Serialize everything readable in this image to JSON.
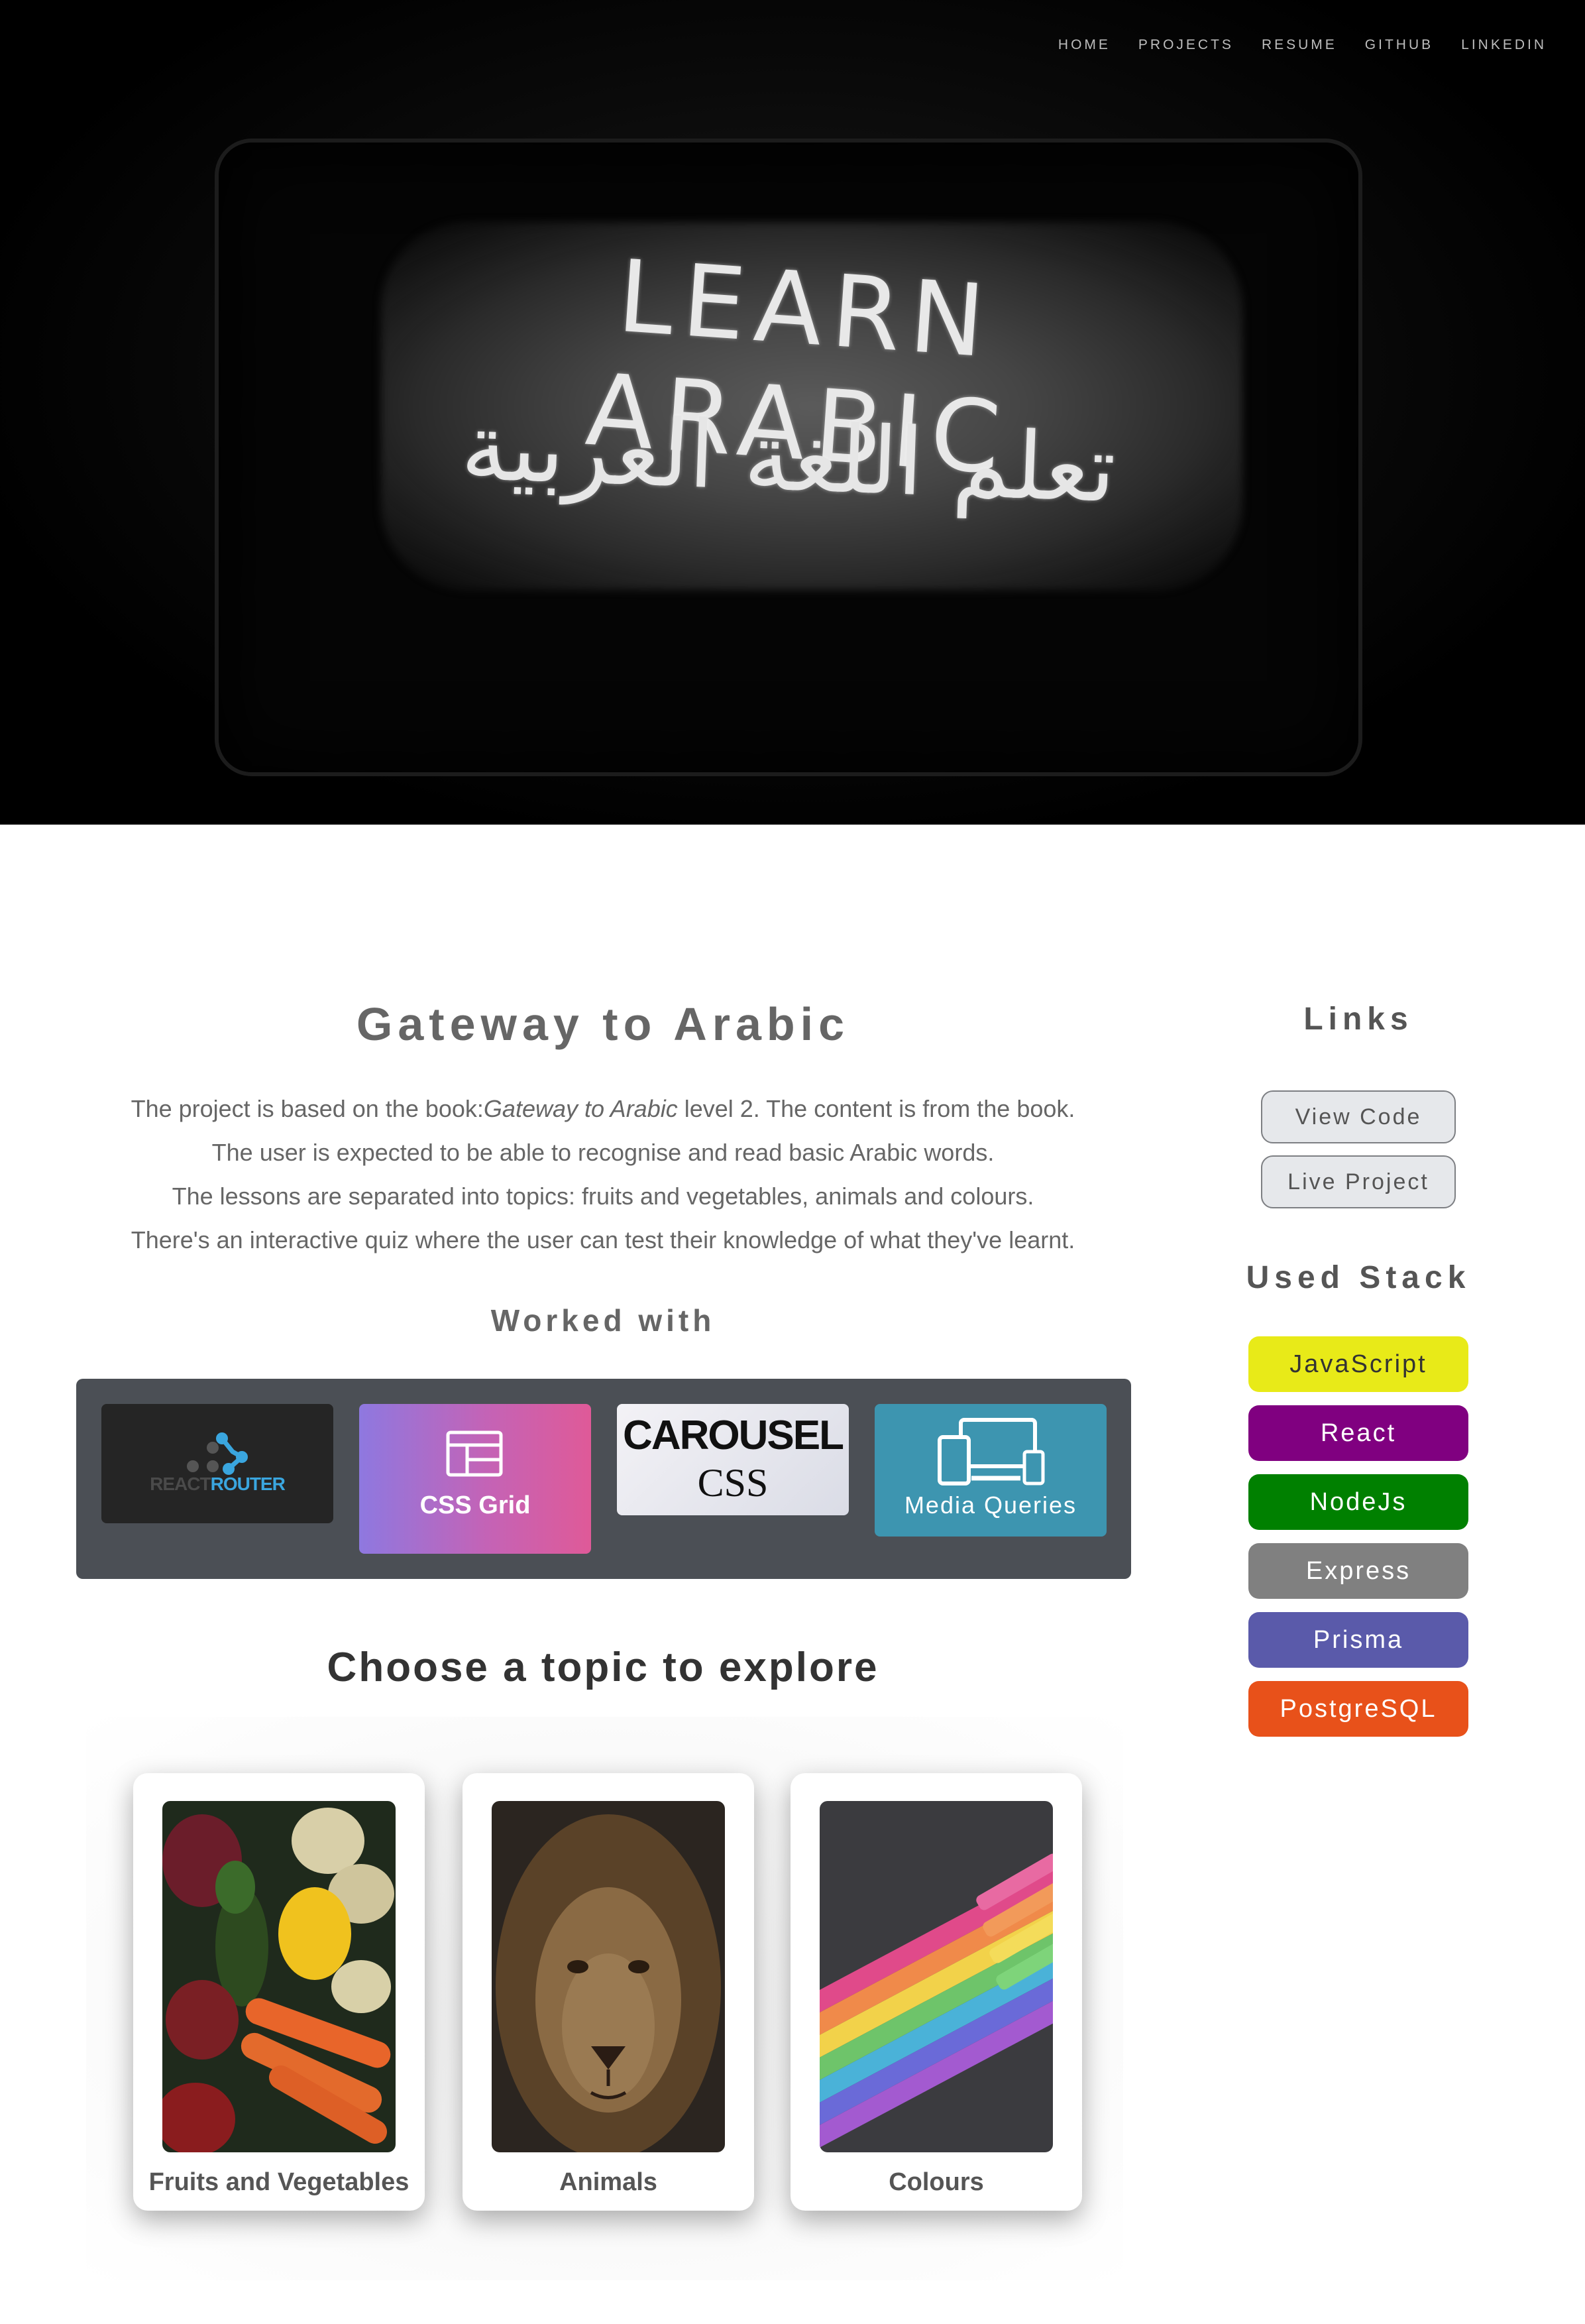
{
  "nav": {
    "items": [
      "HOME",
      "PROJECTS",
      "RESUME",
      "GITHUB",
      "LINKEDIN"
    ]
  },
  "hero": {
    "title_en": "LEARN ARABIC",
    "title_ar": "تعلم اللغة العربية"
  },
  "project": {
    "title": "Gateway to Arabic",
    "description": {
      "line1_before": "The project is based on the book:",
      "line1_book": "Gateway to Arabic",
      "line1_after": " level 2. The content is from the book.",
      "line2": "The user is expected to be able to recognise and read basic Arabic words.",
      "line3": "The lessons are separated into topics: fruits and vegetables, animals and colours.",
      "line4": "There's an interactive quiz where the user can test their knowledge of what they've learnt."
    }
  },
  "worked_with": {
    "heading": "Worked with",
    "router": {
      "label_prefix": "REACT",
      "label_accent": "ROUTER"
    },
    "grid": {
      "label": "CSS Grid"
    },
    "carousel": {
      "line1": "CAROUSEL",
      "line2": "CSS"
    },
    "media_queries": {
      "label": "Media Queries"
    }
  },
  "topics": {
    "heading": "Choose a topic to explore",
    "cards": [
      {
        "label": "Fruits and Vegetables"
      },
      {
        "label": "Animals"
      },
      {
        "label": "Colours"
      }
    ]
  },
  "sidebar": {
    "links_heading": "Links",
    "view_code": "View Code",
    "live_project": "Live Project",
    "stack_heading": "Used Stack",
    "stack": [
      {
        "label": "JavaScript",
        "bg": "#e8ea18",
        "fg": "#333333"
      },
      {
        "label": "React",
        "bg": "#800080",
        "fg": "#ffffff"
      },
      {
        "label": "NodeJs",
        "bg": "#008000",
        "fg": "#ffffff"
      },
      {
        "label": "Express",
        "bg": "#808080",
        "fg": "#ffffff"
      },
      {
        "label": "Prisma",
        "bg": "#5a5aaa",
        "fg": "#ffffff"
      },
      {
        "label": "PostgreSQL",
        "bg": "#e8511a",
        "fg": "#ffffff"
      }
    ]
  }
}
